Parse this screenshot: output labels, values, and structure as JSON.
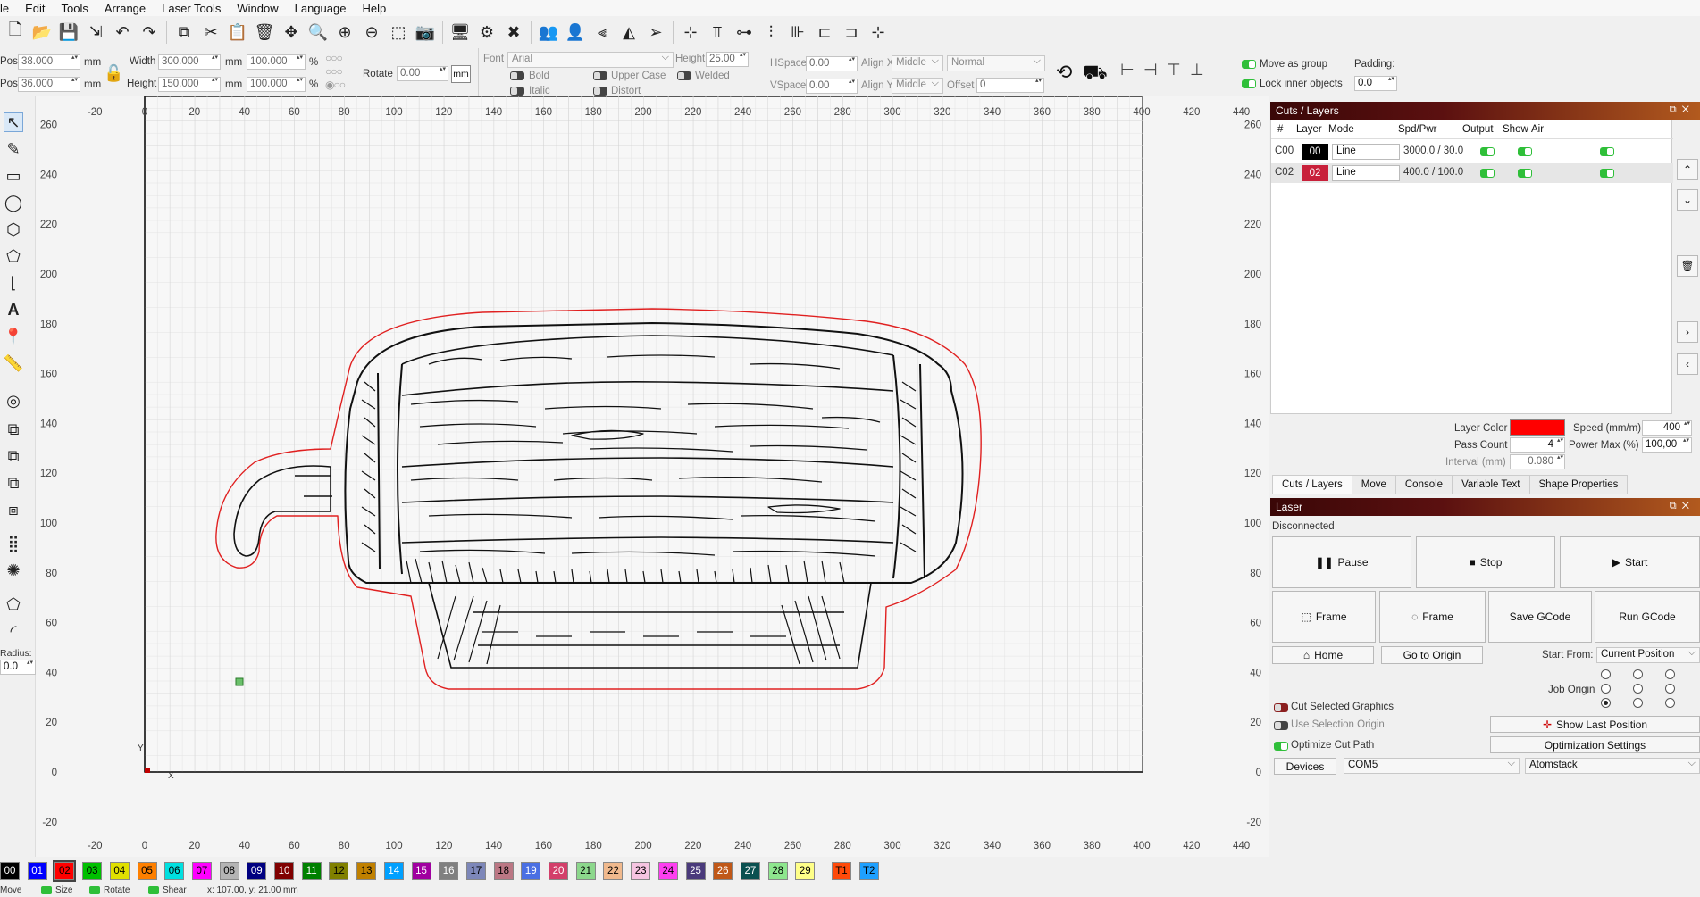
{
  "menu": [
    "le",
    "Edit",
    "Tools",
    "Arrange",
    "Laser Tools",
    "Window",
    "Language",
    "Help"
  ],
  "props": {
    "xpos_label": "Pos",
    "xpos": "38.000",
    "ypos_label": "Pos",
    "ypos": "36.000",
    "unit": "mm",
    "width_label": "Width",
    "width": "300.000",
    "height_label": "Height",
    "height": "150.000",
    "wpct": "100.000",
    "hpct": "100.000",
    "pct": "%",
    "rotate_label": "Rotate",
    "rotate": "0.00",
    "mm_btn": "mm"
  },
  "text": {
    "font_label": "Font",
    "font": "Arial",
    "height_label": "Height",
    "height": "25.00",
    "hspace_label": "HSpace",
    "hspace": "0.00",
    "vspace_label": "VSpace",
    "vspace": "0.00",
    "alignx_label": "Align X",
    "alignx": "Middle",
    "aligny_label": "Align Y",
    "aligny": "Middle",
    "style": "Normal",
    "offset_label": "Offset",
    "offset": "0",
    "bold": "Bold",
    "italic": "Italic",
    "upper": "Upper Case",
    "distort": "Distort",
    "welded": "Welded"
  },
  "group": {
    "move_as_group": "Move as group",
    "lock_inner": "Lock inner objects",
    "padding_label": "Padding:",
    "padding": "0.0"
  },
  "ruler": {
    "x": [
      "-20",
      "0",
      "20",
      "40",
      "60",
      "80",
      "100",
      "120",
      "140",
      "160",
      "180",
      "200",
      "220",
      "240",
      "260",
      "280",
      "300",
      "320",
      "340",
      "360",
      "380",
      "400",
      "420",
      "440"
    ],
    "y": [
      "260",
      "240",
      "220",
      "200",
      "180",
      "160",
      "140",
      "120",
      "100",
      "80",
      "60",
      "40",
      "20",
      "0",
      "-20"
    ],
    "axis_x": "X",
    "axis_y": "Y"
  },
  "left_tools": {
    "radius_label": "Radius:",
    "radius": "0.0"
  },
  "cuts": {
    "title": "Cuts / Layers",
    "headers": [
      "#",
      "Layer",
      "Mode",
      "Spd/Pwr",
      "Output",
      "Show",
      "Air"
    ],
    "rows": [
      {
        "num": "C00",
        "layer": "00",
        "color": "#000000",
        "mode": "Line",
        "spdpwr": "3000.0 / 30.0"
      },
      {
        "num": "C02",
        "layer": "02",
        "color": "#c8203a",
        "mode": "Line",
        "spdpwr": "400.0 / 100.0"
      }
    ],
    "layer_color_label": "Layer Color",
    "layer_color": "#ff0000",
    "speed_label": "Speed (mm/m)",
    "speed": "400",
    "pass_label": "Pass Count",
    "pass": "4",
    "power_label": "Power Max (%)",
    "power": "100,00",
    "interval_label": "Interval (mm)",
    "interval": "0.080",
    "tabs": [
      "Cuts / Layers",
      "Move",
      "Console",
      "Variable Text",
      "Shape Properties"
    ]
  },
  "laser": {
    "title": "Laser",
    "status": "Disconnected",
    "pause": "Pause",
    "stop": "Stop",
    "start": "Start",
    "frame1": "Frame",
    "frame2": "Frame",
    "save_gcode": "Save GCode",
    "run_gcode": "Run GCode",
    "home": "Home",
    "go_origin": "Go to Origin",
    "start_from_label": "Start From:",
    "start_from": "Current Position",
    "job_origin_label": "Job Origin",
    "cut_selected": "Cut Selected Graphics",
    "use_selection": "Use Selection Origin",
    "optimize": "Optimize Cut Path",
    "show_last": "Show Last Position",
    "opt_settings": "Optimization Settings",
    "devices": "Devices",
    "port": "COM5",
    "machine": "Atomstack"
  },
  "palette": [
    {
      "l": "00",
      "c": "#000000",
      "t": "#ffffff"
    },
    {
      "l": "01",
      "c": "#0000ff",
      "t": "#ffffff"
    },
    {
      "l": "02",
      "c": "#ff0000",
      "t": "#000000"
    },
    {
      "l": "03",
      "c": "#00c000",
      "t": "#000000"
    },
    {
      "l": "04",
      "c": "#e0e000",
      "t": "#000000"
    },
    {
      "l": "05",
      "c": "#ff8000",
      "t": "#000000"
    },
    {
      "l": "06",
      "c": "#00e0e0",
      "t": "#000000"
    },
    {
      "l": "07",
      "c": "#ff00ff",
      "t": "#000000"
    },
    {
      "l": "08",
      "c": "#b4b4b4",
      "t": "#000000"
    },
    {
      "l": "09",
      "c": "#000080",
      "t": "#ffffff"
    },
    {
      "l": "10",
      "c": "#800000",
      "t": "#ffffff"
    },
    {
      "l": "11",
      "c": "#008000",
      "t": "#ffffff"
    },
    {
      "l": "12",
      "c": "#808000",
      "t": "#000000"
    },
    {
      "l": "13",
      "c": "#c08000",
      "t": "#000000"
    },
    {
      "l": "14",
      "c": "#00a0ff",
      "t": "#ffffff"
    },
    {
      "l": "15",
      "c": "#a000a0",
      "t": "#ffffff"
    },
    {
      "l": "16",
      "c": "#808080",
      "t": "#ffffff"
    },
    {
      "l": "17",
      "c": "#7d87b9",
      "t": "#000000"
    },
    {
      "l": "18",
      "c": "#bb7784",
      "t": "#000000"
    },
    {
      "l": "19",
      "c": "#4a6fe3",
      "t": "#ffffff"
    },
    {
      "l": "20",
      "c": "#d33f6a",
      "t": "#ffffff"
    },
    {
      "l": "21",
      "c": "#8cd78c",
      "t": "#000000"
    },
    {
      "l": "22",
      "c": "#f0b98d",
      "t": "#000000"
    },
    {
      "l": "23",
      "c": "#f6c4e1",
      "t": "#000000"
    },
    {
      "l": "24",
      "c": "#fe3ef0",
      "t": "#000000"
    },
    {
      "l": "25",
      "c": "#4a3a7b",
      "t": "#ffffff"
    },
    {
      "l": "26",
      "c": "#c05818",
      "t": "#ffffff"
    },
    {
      "l": "27",
      "c": "#0a5050",
      "t": "#ffffff"
    },
    {
      "l": "28",
      "c": "#8ee68e",
      "t": "#000000"
    },
    {
      "l": "29",
      "c": "#ffff88",
      "t": "#000000"
    },
    {
      "l": "T1",
      "c": "#ff4a0a",
      "t": "#000000"
    },
    {
      "l": "T2",
      "c": "#1ea0ff",
      "t": "#000000"
    }
  ],
  "status": {
    "move": "Move",
    "size": "Size",
    "rotate": "Rotate",
    "shear": "Shear",
    "coords": "x: 107.00, y: 21.00 mm"
  }
}
